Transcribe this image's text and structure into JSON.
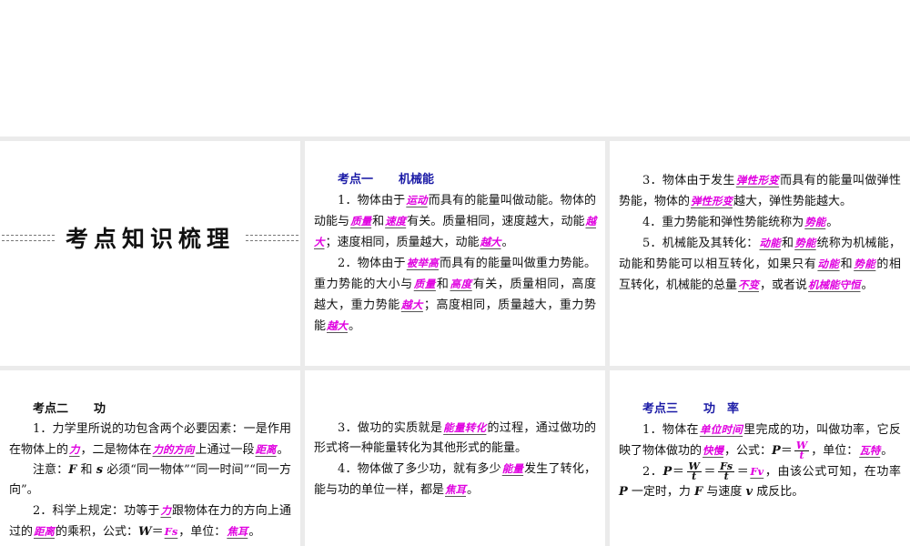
{
  "slides": [
    {
      "title": "考点知识梳理"
    },
    {
      "heading": {
        "num": "考点一",
        "topic": "机械能",
        "color": "blue"
      },
      "paras": [
        [
          {
            "t": "1．物体由于"
          },
          {
            "t": "运动",
            "b": 1
          },
          {
            "t": "而具有的能量叫做动能。物体的动能与"
          },
          {
            "t": "质量",
            "b": 1
          },
          {
            "t": "和"
          },
          {
            "t": "速度",
            "b": 1
          },
          {
            "t": "有关。质量相同，速度越大，动能"
          },
          {
            "t": "越大",
            "b": 1
          },
          {
            "t": "；速度相同，质量越大，动能"
          },
          {
            "t": "越大",
            "b": 1
          },
          {
            "t": "。"
          }
        ],
        [
          {
            "t": "2．物体由于"
          },
          {
            "t": "被举高",
            "b": 1
          },
          {
            "t": "而具有的能量叫做重力势能。重力势能的大小与"
          },
          {
            "t": "质量",
            "b": 1
          },
          {
            "t": "和"
          },
          {
            "t": "高度",
            "b": 1
          },
          {
            "t": "有关，质量相同，高度越大，重力势能"
          },
          {
            "t": "越大",
            "b": 1
          },
          {
            "t": "；高度相同，质量越大，重力势能"
          },
          {
            "t": "越大",
            "b": 1
          },
          {
            "t": "。"
          }
        ]
      ]
    },
    {
      "paras": [
        [
          {
            "t": "3．物体由于发生"
          },
          {
            "t": "弹性形变",
            "b": 1
          },
          {
            "t": "而具有的能量叫做弹性势能，物体的"
          },
          {
            "t": "弹性形变",
            "b": 1
          },
          {
            "t": "越大，弹性势能越大。"
          }
        ],
        [
          {
            "t": "4．重力势能和弹性势能统称为"
          },
          {
            "t": "势能",
            "b": 1
          },
          {
            "t": "。"
          }
        ],
        [
          {
            "t": "5．机械能及其转化："
          },
          {
            "t": "动能",
            "b": 1
          },
          {
            "t": "和"
          },
          {
            "t": "势能",
            "b": 1
          },
          {
            "t": "统称为机械能，动能和势能可以相互转化，如果只有"
          },
          {
            "t": "动能",
            "b": 1
          },
          {
            "t": "和"
          },
          {
            "t": "势能",
            "b": 1
          },
          {
            "t": "的相互转化，机械能的总量"
          },
          {
            "t": "不变",
            "b": 1
          },
          {
            "t": "，或者说"
          },
          {
            "t": "机械能守恒",
            "b": 1
          },
          {
            "t": "。"
          }
        ]
      ]
    },
    {
      "heading": {
        "num": "考点二",
        "topic": "功",
        "color": "black"
      },
      "paras": [
        [
          {
            "t": "1．力学里所说的功包含两个必要因素：一是作用在物体上的"
          },
          {
            "t": "力",
            "b": 1
          },
          {
            "t": "，二是物体在"
          },
          {
            "t": "力的方向",
            "b": 1
          },
          {
            "t": "上通过一段"
          },
          {
            "t": "距离",
            "b": 1
          },
          {
            "t": "。"
          }
        ],
        [
          {
            "t": "注意："
          },
          {
            "t": "F",
            "i": 1
          },
          {
            "t": " 和 "
          },
          {
            "t": "s",
            "i": 1
          },
          {
            "t": " 必须“同一物体”“同一时间”“同一方向”。"
          }
        ],
        [
          {
            "t": "2．科学上规定：功等于"
          },
          {
            "t": "力",
            "b": 1
          },
          {
            "t": "跟物体在力的方向上通过的"
          },
          {
            "t": "距离",
            "b": 1
          },
          {
            "t": "的乘积，公式："
          },
          {
            "t": "W",
            "i": 1
          },
          {
            "t": "＝"
          },
          {
            "t": "Fs",
            "b": 1
          },
          {
            "t": "，单位："
          },
          {
            "t": "焦耳",
            "b": 1
          },
          {
            "t": "。"
          }
        ]
      ]
    },
    {
      "paras": [
        [
          {
            "t": "3．做功的实质就是"
          },
          {
            "t": "能量转化",
            "b": 1
          },
          {
            "t": "的过程，通过做功的形式将一种能量转化为其他形式的能量。"
          }
        ],
        [
          {
            "t": "4．物体做了多少功，就有多少"
          },
          {
            "t": "能量",
            "b": 1
          },
          {
            "t": "发生了转化，能与功的单位一样，都是"
          },
          {
            "t": "焦耳",
            "b": 1
          },
          {
            "t": "。"
          }
        ]
      ]
    },
    {
      "heading": {
        "num": "考点三",
        "topic": "功　率",
        "color": "blue"
      },
      "paras": [
        [
          {
            "t": "1．物体在"
          },
          {
            "t": "单位时间",
            "b": 1
          },
          {
            "t": "里完成的功，叫做功率，它反映了物体做功的"
          },
          {
            "t": "快慢",
            "b": 1
          },
          {
            "t": "，公式："
          },
          {
            "t": "P",
            "i": 1
          },
          {
            "t": "＝"
          },
          {
            "f": 1,
            "n": "W",
            "d": "t",
            "pink": 1
          },
          {
            "t": "，单位："
          },
          {
            "t": "瓦特",
            "b": 1
          },
          {
            "t": "。"
          }
        ],
        [
          {
            "t": "2．"
          },
          {
            "t": "P",
            "i": 1
          },
          {
            "t": "＝"
          },
          {
            "f": 1,
            "n": "W",
            "d": "t"
          },
          {
            "t": "＝"
          },
          {
            "f": 1,
            "n": "Fs",
            "d": "t"
          },
          {
            "t": "＝"
          },
          {
            "t": "Fv",
            "b": 1
          },
          {
            "t": "，由该公式可知，在功率 "
          },
          {
            "t": "P",
            "i": 1
          },
          {
            "t": " 一定时，力 "
          },
          {
            "t": "F",
            "i": 1
          },
          {
            "t": " 与速度 "
          },
          {
            "t": "v",
            "i": 1
          },
          {
            "t": " 成反比。"
          }
        ]
      ]
    }
  ],
  "colors": {
    "blank": "#e000e0",
    "heading_blue": "#1a1aa6",
    "gap": "#ebebeb"
  }
}
